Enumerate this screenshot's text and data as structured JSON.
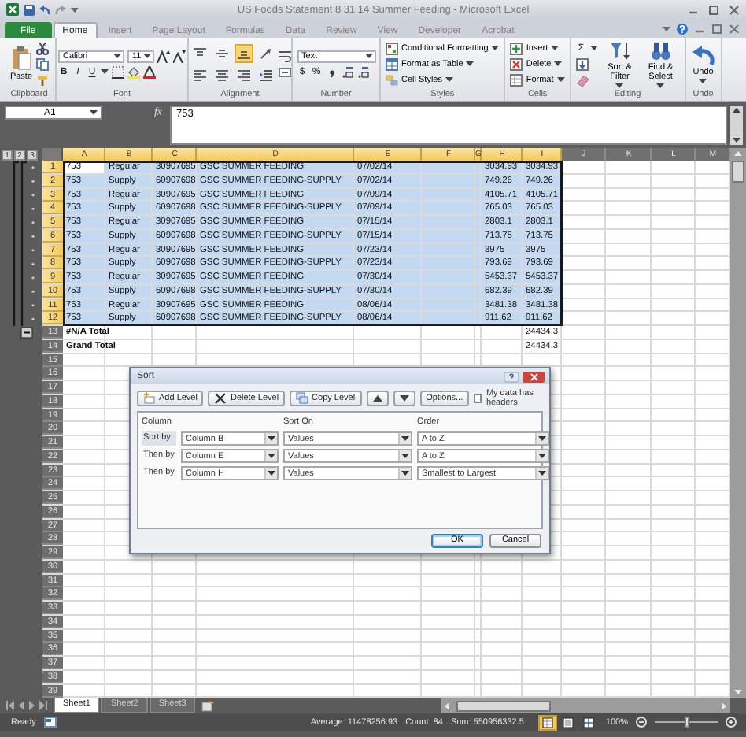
{
  "window": {
    "title": "US Foods Statement 8 31 14 Summer Feeding - Microsoft Excel"
  },
  "tabs": [
    {
      "label": "File",
      "kind": "file",
      "selected": false
    },
    {
      "label": "Home",
      "kind": "tab",
      "selected": true
    },
    {
      "label": "Insert",
      "kind": "tab",
      "selected": false
    },
    {
      "label": "Page Layout",
      "kind": "tab",
      "selected": false
    },
    {
      "label": "Formulas",
      "kind": "tab",
      "selected": false
    },
    {
      "label": "Data",
      "kind": "tab",
      "selected": false
    },
    {
      "label": "Review",
      "kind": "tab",
      "selected": false
    },
    {
      "label": "View",
      "kind": "tab",
      "selected": false
    },
    {
      "label": "Developer",
      "kind": "tab",
      "selected": false
    },
    {
      "label": "Acrobat",
      "kind": "tab",
      "selected": false
    }
  ],
  "ribbon": [
    {
      "kind": "clipboard",
      "label": "Clipboard",
      "items": [
        "Paste"
      ]
    },
    {
      "kind": "font",
      "label": "Font",
      "font": "Calibri",
      "size": "11",
      "buttons": [
        {
          "label": "B",
          "kind": "bold"
        },
        {
          "label": "I",
          "kind": "italic"
        },
        {
          "label": "U",
          "kind": "underline"
        }
      ]
    },
    {
      "kind": "alignment",
      "label": "Alignment",
      "buttons": [
        {
          "kind": "top",
          "on": false
        },
        {
          "kind": "middle",
          "on": false
        },
        {
          "kind": "bottom",
          "on": true
        },
        {
          "kind": "orientation",
          "on": false
        },
        {
          "kind": "left",
          "on": false
        },
        {
          "kind": "center",
          "on": false
        },
        {
          "kind": "right",
          "on": false
        },
        {
          "kind": "indent",
          "on": false
        }
      ]
    },
    {
      "kind": "number",
      "label": "Number",
      "format": "Text",
      "buttons": [
        "$",
        "%"
      ]
    },
    {
      "kind": "list",
      "label": "Styles",
      "items": [
        {
          "label": "Conditional Formatting",
          "kind": "conditional"
        },
        {
          "label": "Format as Table",
          "kind": "table"
        },
        {
          "label": "Cell Styles",
          "kind": "styles"
        }
      ]
    },
    {
      "kind": "list",
      "label": "Cells",
      "items": [
        {
          "label": "Insert",
          "kind": "insert"
        },
        {
          "label": "Delete",
          "kind": "delete"
        },
        {
          "label": "Format",
          "kind": "format"
        }
      ]
    },
    {
      "kind": "editing",
      "label": "Editing",
      "symbol": "Σ",
      "items": [
        {
          "label": "Sort & Filter",
          "kind": "sort"
        },
        {
          "label": "Find & Select",
          "kind": "find"
        }
      ]
    },
    {
      "kind": "undo",
      "label": "Undo",
      "items": [
        {
          "label": "Undo",
          "kind": "undo"
        }
      ]
    }
  ],
  "formula_bar": {
    "name_box": "A1",
    "function_label": "fx",
    "value": "753"
  },
  "sheet": {
    "outline_levels": [
      "1",
      "2",
      "3"
    ],
    "columns": [
      {
        "label": "A",
        "selected": true
      },
      {
        "label": "B",
        "selected": true
      },
      {
        "label": "C",
        "selected": true
      },
      {
        "label": "D",
        "selected": true
      },
      {
        "label": "E",
        "selected": true
      },
      {
        "label": "F",
        "selected": true
      },
      {
        "label": "G",
        "selected": true
      },
      {
        "label": "H",
        "selected": true
      },
      {
        "label": "I",
        "selected": true
      },
      {
        "label": "J",
        "selected": false
      },
      {
        "label": "K",
        "selected": false
      },
      {
        "label": "L",
        "selected": false
      },
      {
        "label": "M",
        "selected": false
      }
    ],
    "rows": [
      {
        "row": "1",
        "kind": "data",
        "selected": true,
        "active": true,
        "cells": {
          "A": "753",
          "B": "Regular",
          "C": "30907695",
          "D": "GSC SUMMER FEEDING",
          "E": "07/02/14",
          "H": "3034.93",
          "I": "3034.93"
        }
      },
      {
        "row": "2",
        "kind": "data",
        "selected": true,
        "active": false,
        "cells": {
          "A": "753",
          "B": "Supply",
          "C": "60907698",
          "D": "GSC SUMMER FEEDING-SUPPLY",
          "E": "07/02/14",
          "H": "749.26",
          "I": "749.26"
        }
      },
      {
        "row": "3",
        "kind": "data",
        "selected": true,
        "active": false,
        "cells": {
          "A": "753",
          "B": "Regular",
          "C": "30907695",
          "D": "GSC SUMMER FEEDING",
          "E": "07/09/14",
          "H": "4105.71",
          "I": "4105.71"
        }
      },
      {
        "row": "4",
        "kind": "data",
        "selected": true,
        "active": false,
        "cells": {
          "A": "753",
          "B": "Supply",
          "C": "60907698",
          "D": "GSC SUMMER FEEDING-SUPPLY",
          "E": "07/09/14",
          "H": "765.03",
          "I": "765.03"
        }
      },
      {
        "row": "5",
        "kind": "data",
        "selected": true,
        "active": false,
        "cells": {
          "A": "753",
          "B": "Regular",
          "C": "30907695",
          "D": "GSC SUMMER FEEDING",
          "E": "07/15/14",
          "H": "2803.1",
          "I": "2803.1"
        }
      },
      {
        "row": "6",
        "kind": "data",
        "selected": true,
        "active": false,
        "cells": {
          "A": "753",
          "B": "Supply",
          "C": "60907698",
          "D": "GSC SUMMER FEEDING-SUPPLY",
          "E": "07/15/14",
          "H": "713.75",
          "I": "713.75"
        }
      },
      {
        "row": "7",
        "kind": "data",
        "selected": true,
        "active": false,
        "cells": {
          "A": "753",
          "B": "Regular",
          "C": "30907695",
          "D": "GSC SUMMER FEEDING",
          "E": "07/23/14",
          "H": "3975",
          "I": "3975"
        }
      },
      {
        "row": "8",
        "kind": "data",
        "selected": true,
        "active": false,
        "cells": {
          "A": "753",
          "B": "Supply",
          "C": "60907698",
          "D": "GSC SUMMER FEEDING-SUPPLY",
          "E": "07/23/14",
          "H": "793.69",
          "I": "793.69"
        }
      },
      {
        "row": "9",
        "kind": "data",
        "selected": true,
        "active": false,
        "cells": {
          "A": "753",
          "B": "Regular",
          "C": "30907695",
          "D": "GSC SUMMER FEEDING",
          "E": "07/30/14",
          "H": "5453.37",
          "I": "5453.37"
        }
      },
      {
        "row": "10",
        "kind": "data",
        "selected": true,
        "active": false,
        "cells": {
          "A": "753",
          "B": "Supply",
          "C": "60907698",
          "D": "GSC SUMMER FEEDING-SUPPLY",
          "E": "07/30/14",
          "H": "682.39",
          "I": "682.39"
        }
      },
      {
        "row": "11",
        "kind": "data",
        "selected": true,
        "active": false,
        "cells": {
          "A": "753",
          "B": "Regular",
          "C": "30907695",
          "D": "GSC SUMMER FEEDING",
          "E": "08/06/14",
          "H": "3481.38",
          "I": "3481.38"
        }
      },
      {
        "row": "12",
        "kind": "data",
        "selected": true,
        "active": false,
        "cells": {
          "A": "753",
          "B": "Supply",
          "C": "60907698",
          "D": "GSC SUMMER FEEDING-SUPPLY",
          "E": "08/06/14",
          "H": "911.62",
          "I": "911.62"
        }
      },
      {
        "row": "13",
        "kind": "total",
        "selected": false,
        "active": false,
        "cells": {
          "A": "#N/A Total",
          "I": "24434.3"
        }
      },
      {
        "row": "14",
        "kind": "total",
        "selected": false,
        "active": false,
        "cells": {
          "A": "Grand Total",
          "I": "24434.3"
        }
      }
    ],
    "empty_rows": [
      "15",
      "16",
      "17",
      "18",
      "19",
      "20",
      "21",
      "22",
      "23",
      "24",
      "25",
      "26",
      "27",
      "28",
      "29",
      "30",
      "31",
      "32",
      "33",
      "34",
      "35",
      "36",
      "37",
      "38",
      "39"
    ]
  },
  "sort_dialog": {
    "title": "Sort",
    "toolbar": [
      {
        "label": "Add Level",
        "kind": "add"
      },
      {
        "label": "Delete Level",
        "kind": "delete"
      },
      {
        "label": "Copy Level",
        "kind": "copy"
      },
      {
        "kind": "up"
      },
      {
        "kind": "down"
      },
      {
        "label": "Options...",
        "kind": "options"
      }
    ],
    "headers_checkbox": {
      "label": "My data has headers",
      "checked": false
    },
    "columns": [
      "Column",
      "Sort On",
      "Order"
    ],
    "levels": [
      {
        "label": "Sort by",
        "column": "Column B",
        "sort_on": "Values",
        "order": "A to Z",
        "selected": true
      },
      {
        "label": "Then by",
        "column": "Column E",
        "sort_on": "Values",
        "order": "A to Z",
        "selected": false
      },
      {
        "label": "Then by",
        "column": "Column H",
        "sort_on": "Values",
        "order": "Smallest to Largest",
        "selected": false
      }
    ],
    "buttons": [
      {
        "label": "OK",
        "default": true
      },
      {
        "label": "Cancel",
        "default": false
      }
    ]
  },
  "sheet_tabs": [
    {
      "label": "Sheet1",
      "selected": true
    },
    {
      "label": "Sheet2",
      "selected": false
    },
    {
      "label": "Sheet3",
      "selected": false
    }
  ],
  "status_bar": {
    "mode": "Ready",
    "average": "Average: 11478256.93",
    "count": "Count: 84",
    "sum": "Sum: 550956332.5",
    "views": [
      {
        "kind": "normal",
        "selected": true
      },
      {
        "kind": "layout",
        "selected": false
      },
      {
        "kind": "break",
        "selected": false
      }
    ],
    "zoom": "100%",
    "zoom_slider": {
      "level": 0.5
    }
  }
}
